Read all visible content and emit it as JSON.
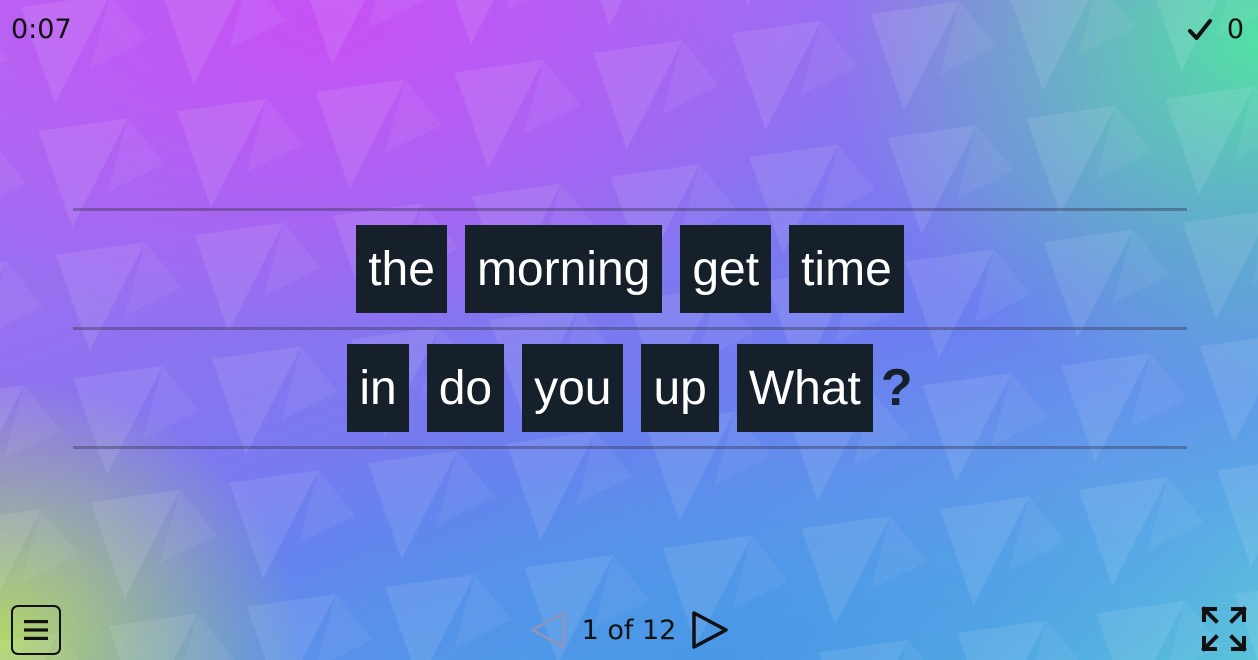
{
  "hud": {
    "timer": "0:07",
    "score": "0"
  },
  "sentence": {
    "row1": [
      "the",
      "morning",
      "get",
      "time"
    ],
    "row2": [
      "in",
      "do",
      "you",
      "up",
      "What"
    ],
    "punctuation": "?"
  },
  "pager": {
    "text": "1 of 12"
  },
  "colors": {
    "tile": "#16202b",
    "tile_text": "#ffffff"
  },
  "icons": {
    "score": "check-icon",
    "menu": "menu-icon",
    "prev": "triangle-left-icon",
    "next": "triangle-right-icon",
    "fullscreen": "fullscreen-icon"
  }
}
